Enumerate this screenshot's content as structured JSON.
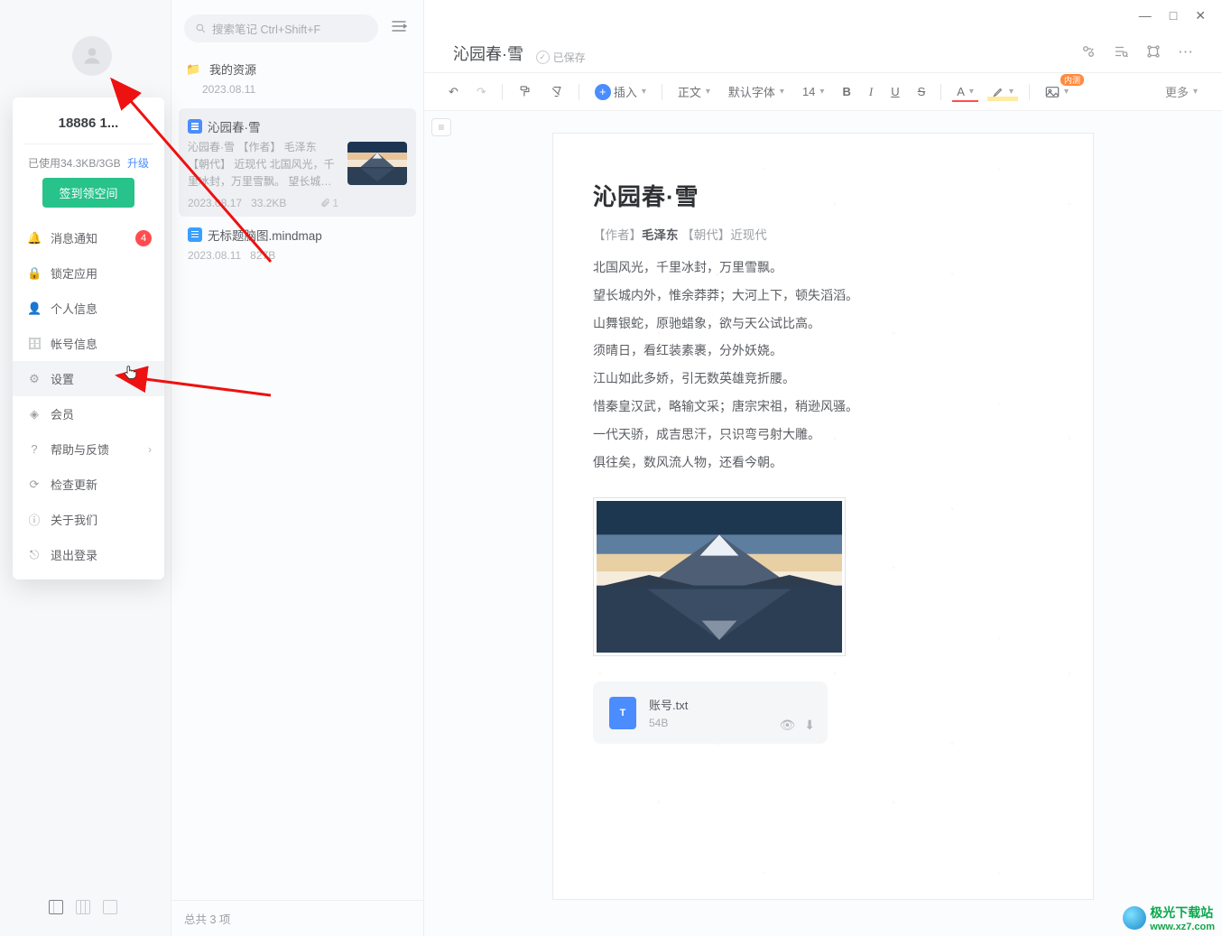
{
  "window": {
    "min": "—",
    "max": "□",
    "close": "✕"
  },
  "profile": {
    "username": "18886 1...",
    "usage_text": "已使用34.3KB/3GB",
    "upgrade": "升级",
    "signin_btn": "签到领空间",
    "menu": [
      {
        "key": "msg",
        "label": "消息通知",
        "icon": "🔔",
        "badge": "4"
      },
      {
        "key": "lock",
        "label": "锁定应用",
        "icon": "🔒"
      },
      {
        "key": "personal",
        "label": "个人信息",
        "icon": "👤"
      },
      {
        "key": "account",
        "label": "帐号信息",
        "icon": "🗄"
      },
      {
        "key": "settings",
        "label": "设置",
        "icon": "⚙",
        "highlight": true
      },
      {
        "key": "vip",
        "label": "会员",
        "icon": "◈"
      },
      {
        "key": "help",
        "label": "帮助与反馈",
        "icon": "?",
        "chev": "›"
      },
      {
        "key": "update",
        "label": "检查更新",
        "icon": "⟳"
      },
      {
        "key": "about",
        "label": "关于我们",
        "icon": "ⓘ"
      },
      {
        "key": "logout",
        "label": "退出登录",
        "icon": "⎋"
      }
    ]
  },
  "search": {
    "placeholder": "搜索笔记 Ctrl+Shift+F"
  },
  "list": {
    "folder": {
      "name": "我的资源",
      "date": "2023.08.11"
    },
    "items": [
      {
        "title": "沁园春·雪",
        "excerpt": "沁园春·雪 【作者】 毛泽东 【朝代】 近现代 北国风光，千里冰封，万里雪飘。 望长城内外，惟…",
        "date": "2023.08.17",
        "size": "33.2KB",
        "attach": "1"
      },
      {
        "title": "无标题脑图.mindmap",
        "date": "2023.08.11",
        "size": "827B"
      }
    ],
    "footer": "总共 3 项"
  },
  "doc": {
    "header_title": "沁园春·雪",
    "saved": "已保存",
    "toolbar": {
      "insert": "插入",
      "style": "正文",
      "font": "默认字体",
      "size": "14",
      "more": "更多",
      "badge": "内测"
    },
    "body": {
      "title": "沁园春·雪",
      "author_label": "【作者】",
      "author": "毛泽东",
      "era_label": "【朝代】",
      "era": "近现代",
      "lines": [
        "北国风光，千里冰封，万里雪飘。",
        "望长城内外，惟余莽莽；大河上下，顿失滔滔。",
        "山舞银蛇，原驰蜡象，欲与天公试比高。",
        "须晴日，看红装素裹，分外妖娆。",
        "江山如此多娇，引无数英雄竞折腰。",
        "惜秦皇汉武，略输文采；唐宗宋祖，稍逊风骚。",
        "一代天骄，成吉思汗，只识弯弓射大雕。",
        "俱往矣，数风流人物，还看今朝。"
      ]
    },
    "attachment": {
      "name": "账号.txt",
      "size": "54B"
    }
  },
  "watermark": {
    "name": "极光下载站",
    "url": "www.xz7.com"
  }
}
